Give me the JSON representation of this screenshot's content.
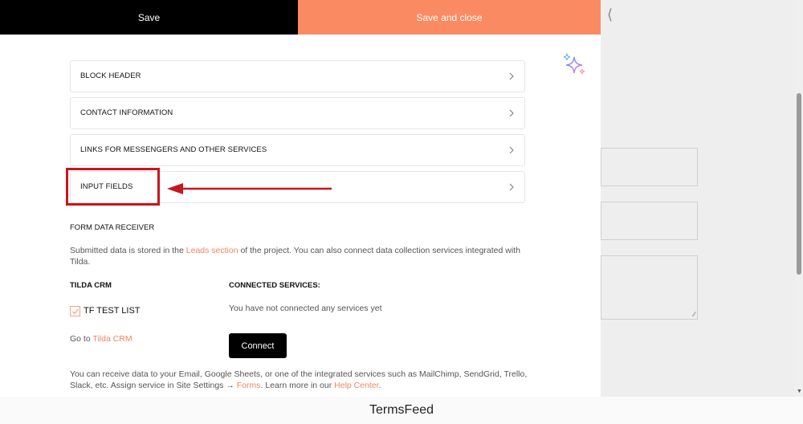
{
  "toolbar": {
    "save_label": "Save",
    "save_close_label": "Save and close"
  },
  "accordion": [
    {
      "label": "BLOCK HEADER"
    },
    {
      "label": "CONTACT INFORMATION"
    },
    {
      "label": "LINKS FOR MESSENGERS AND OTHER SERVICES"
    },
    {
      "label": "INPUT FIELDS"
    }
  ],
  "form_receiver": {
    "title": "FORM DATA RECEIVER",
    "desc_before": "Submitted data is stored in the ",
    "desc_link": "Leads section",
    "desc_after": " of the project. You can also connect data collection services integrated with Tilda.",
    "tilda_crm_heading": "TILDA CRM",
    "connected_heading": "CONNECTED SERVICES:",
    "checkbox_label": "TF TEST LIST",
    "no_services_text": "You have not connected any services yet",
    "goto_prefix": "Go to ",
    "goto_link": "Tilda CRM",
    "connect_label": "Connect",
    "bottom_before": "You can receive data to your Email, Google Sheets, or one of the integrated services such as MailChimp, SendGrid, Trello, Slack, etc. Assign service in Site Settings → ",
    "bottom_forms_link": "Forms",
    "bottom_middle": ". Learn more in our ",
    "bottom_help_link": "Help Center",
    "bottom_end": "."
  },
  "icons": {
    "ai_sparkle": "sparkle-icon",
    "chevron": "chevron-right-icon",
    "back": "chevron-left-icon",
    "check": "checkmark-icon"
  },
  "colors": {
    "accent": "#fa8a62",
    "link": "#f4845f",
    "highlight": "#c8161d"
  },
  "watermark": "TermsFeed"
}
